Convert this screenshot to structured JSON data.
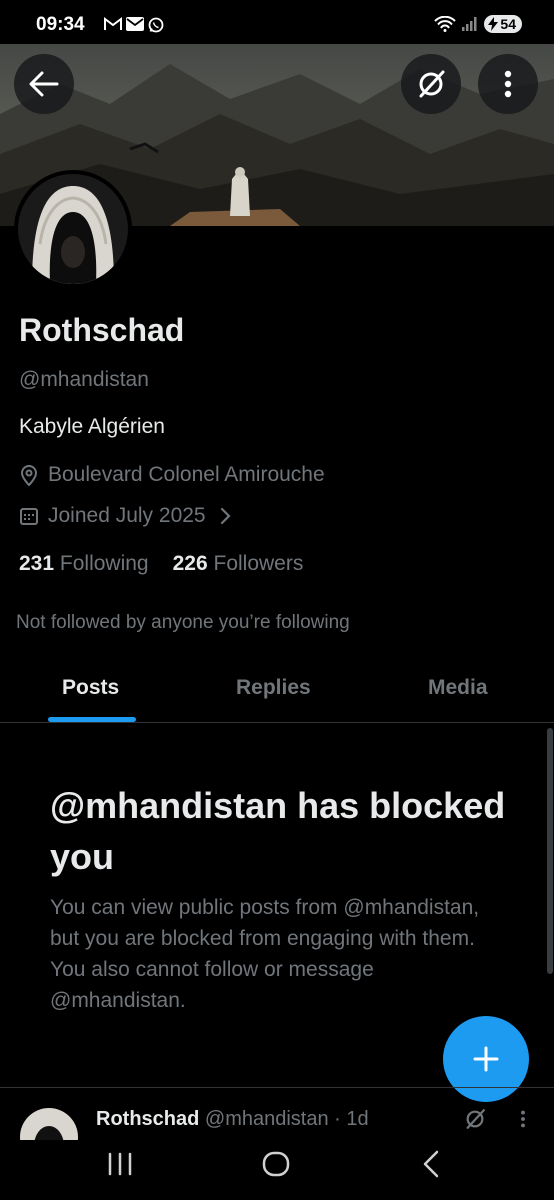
{
  "status_bar": {
    "time": "09:34",
    "battery": "54",
    "left_icons": [
      "gmail-icon",
      "mail-icon",
      "whatsapp-icon"
    ],
    "right_icons": [
      "wifi-icon",
      "signal-icon",
      "battery-icon"
    ]
  },
  "header": {
    "back_icon": "arrow-left-icon",
    "grok_icon": "grok-icon",
    "more_icon": "more-vertical-icon"
  },
  "profile": {
    "name": "Rothschad",
    "handle": "@mhandistan",
    "bio": "Kabyle Algérien",
    "location": "Boulevard Colonel Amirouche",
    "joined": "Joined July 2025",
    "following_count": "231",
    "following_label": "Following",
    "followers_count": "226",
    "followers_label": "Followers",
    "not_followed_text": "Not followed by anyone you’re following"
  },
  "tabs": [
    {
      "label": "Posts",
      "active": true
    },
    {
      "label": "Replies",
      "active": false
    },
    {
      "label": "Media",
      "active": false
    }
  ],
  "blocked": {
    "title": "@mhandistan has blocked you",
    "description": "You can view public posts from @mhandistan, but you are blocked from engaging with them. You also cannot follow or message @mhandistan."
  },
  "fab": {
    "icon": "plus-icon"
  },
  "post_preview": {
    "author_name": "Rothschad",
    "author_handle": "@mhandistan",
    "separator": "·",
    "time": "1d"
  },
  "colors": {
    "background": "#000000",
    "accent": "#1d9bf0",
    "primary_text": "#e7e9ea",
    "secondary_text": "#71767b",
    "divider": "#2f3336"
  }
}
